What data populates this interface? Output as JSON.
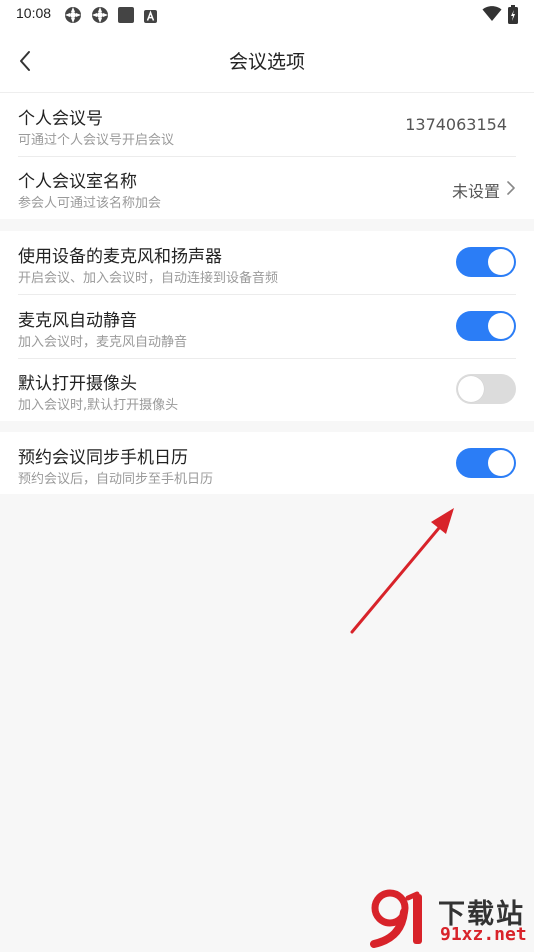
{
  "status_bar": {
    "time": "10:08",
    "icons": [
      "app-icon",
      "app-icon",
      "square-icon",
      "a-icon"
    ],
    "right_icons": [
      "wifi-icon",
      "battery-charging-icon"
    ]
  },
  "header": {
    "title": "会议选项",
    "back_icon": "chevron-left-icon"
  },
  "sections": [
    {
      "rows": [
        {
          "title": "个人会议号",
          "subtitle": "可通过个人会议号开启会议",
          "value": "1374063154"
        },
        {
          "title": "个人会议室名称",
          "subtitle": "参会人可通过该名称加会",
          "value": "未设置",
          "icon": "chevron-right-icon"
        }
      ]
    },
    {
      "rows": [
        {
          "title": "使用设备的麦克风和扬声器",
          "subtitle": "开启会议、加入会议时，自动连接到设备音频",
          "toggle": true
        },
        {
          "title": "麦克风自动静音",
          "subtitle": "加入会议时，麦克风自动静音",
          "toggle": true
        },
        {
          "title": "默认打开摄像头",
          "subtitle": "加入会议时,默认打开摄像头",
          "toggle": false
        }
      ]
    },
    {
      "rows": [
        {
          "title": "预约会议同步手机日历",
          "subtitle": "预约会议后，自动同步至手机日历",
          "toggle": true
        }
      ]
    }
  ],
  "watermark": {
    "name": "下载站",
    "domain": "91xz.net"
  },
  "colors": {
    "accent": "#2b7df6",
    "toggle_off": "#dcdcdc",
    "annotation_arrow": "#d8232a",
    "background": "#f7f7f7"
  }
}
